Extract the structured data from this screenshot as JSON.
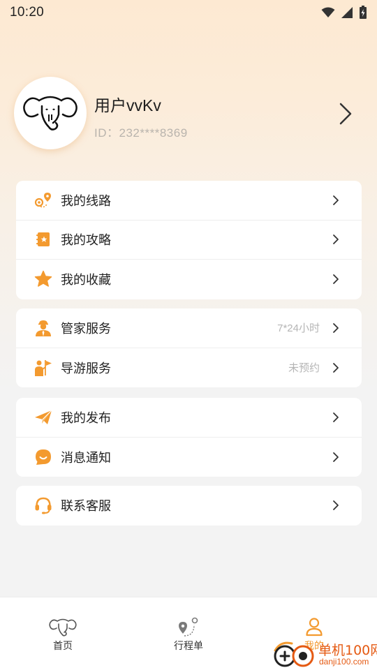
{
  "status_bar": {
    "time": "10:20",
    "icons": [
      "wifi-icon",
      "cellular-signal-icon",
      "battery-icon"
    ]
  },
  "profile": {
    "avatar_icon": "elephant-logo-icon",
    "username": "用户vvKv",
    "user_id": "ID：232****8369"
  },
  "sections": [
    {
      "items": [
        {
          "label": "我的线路",
          "icon": "route-pin-icon",
          "value": ""
        },
        {
          "label": "我的攻略",
          "icon": "guide-book-icon",
          "value": ""
        },
        {
          "label": "我的收藏",
          "icon": "star-icon",
          "value": ""
        }
      ]
    },
    {
      "items": [
        {
          "label": "管家服务",
          "icon": "butler-icon",
          "value": "7*24小时"
        },
        {
          "label": "导游服务",
          "icon": "tour-guide-flag-icon",
          "value": "未预约"
        }
      ]
    },
    {
      "items": [
        {
          "label": "我的发布",
          "icon": "paper-plane-icon",
          "value": ""
        },
        {
          "label": "消息通知",
          "icon": "message-bubble-icon",
          "value": ""
        }
      ]
    },
    {
      "items": [
        {
          "label": "联系客服",
          "icon": "headset-icon",
          "value": ""
        }
      ]
    }
  ],
  "tab_bar": {
    "tabs": [
      {
        "label": "首页",
        "icon": "elephant-home-icon",
        "active": false
      },
      {
        "label": "行程单",
        "icon": "itinerary-pin-icon",
        "active": false
      },
      {
        "label": "我的",
        "icon": "user-profile-icon",
        "active": true
      }
    ]
  },
  "watermark": {
    "title": "单机100网",
    "url": "danji100.com"
  },
  "colors": {
    "accent": "#f39a2f",
    "watermark": "#e55a13",
    "header_gradient_top": "#fde9d2"
  }
}
